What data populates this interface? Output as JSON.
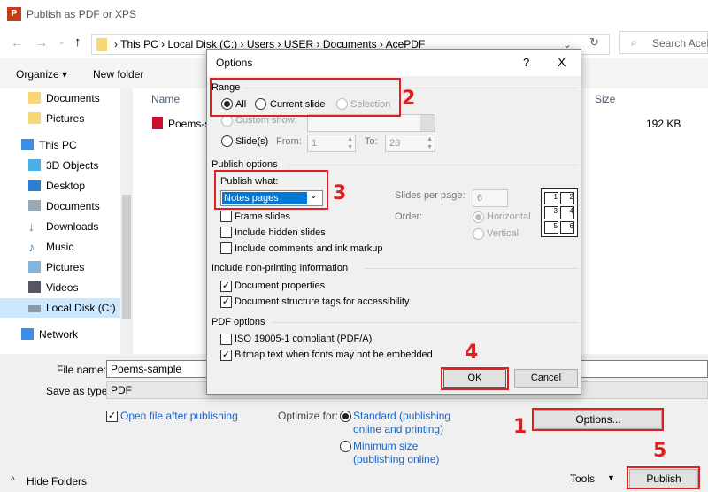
{
  "window": {
    "title": "Publish as PDF or XPS",
    "app_icon": "powerpoint-icon"
  },
  "address": {
    "crumbs": [
      "This PC",
      "Local Disk (C:)",
      "Users",
      "USER",
      "Documents",
      "AcePDF"
    ],
    "search_placeholder": "Search AcePDF"
  },
  "toolbar": {
    "organize": "Organize ▾",
    "new_folder": "New folder"
  },
  "sidebar": {
    "items": [
      {
        "label": "Documents",
        "icon": "folder-icon"
      },
      {
        "label": "Pictures",
        "icon": "folder-icon"
      },
      {
        "label": "This PC",
        "icon": "computer-icon"
      },
      {
        "label": "3D Objects",
        "icon": "cube-icon"
      },
      {
        "label": "Desktop",
        "icon": "desktop-icon"
      },
      {
        "label": "Documents",
        "icon": "documents-icon"
      },
      {
        "label": "Downloads",
        "icon": "download-icon"
      },
      {
        "label": "Music",
        "icon": "music-icon"
      },
      {
        "label": "Pictures",
        "icon": "pictures-icon"
      },
      {
        "label": "Videos",
        "icon": "video-icon"
      },
      {
        "label": "Local Disk (C:)",
        "icon": "drive-icon",
        "selected": true
      },
      {
        "label": "Network",
        "icon": "network-icon"
      }
    ]
  },
  "files": {
    "columns": {
      "name": "Name",
      "size": "Size"
    },
    "rows": [
      {
        "name": "Poems-s",
        "size": "192 KB"
      }
    ]
  },
  "form": {
    "file_name_label": "File name:",
    "file_name": "Poems-sample",
    "type_label": "Save as type:",
    "type": "PDF",
    "open_after": "Open file after publishing",
    "optimize_label": "Optimize for:",
    "standard": "Standard (publishing",
    "standard2": "online and printing)",
    "minimum": "Minimum size",
    "minimum2": "(publishing online)",
    "options": "Options...",
    "hide_folders": "Hide Folders",
    "tools": "Tools",
    "publish": "Publish"
  },
  "dialog": {
    "title": "Options",
    "help": "?",
    "close": "X",
    "range": {
      "label": "Range",
      "all": "All",
      "current": "Current slide",
      "selection": "Selection",
      "custom": "Custom show:",
      "slides": "Slide(s)",
      "from_label": "From:",
      "from": "1",
      "to_label": "To:",
      "to": "28"
    },
    "publish": {
      "label": "Publish options",
      "what_label": "Publish what:",
      "what": "Notes pages",
      "spp_label": "Slides per page:",
      "spp": "6",
      "order_label": "Order:",
      "horizontal": "Horizontal",
      "vertical": "Vertical",
      "frame": "Frame slides",
      "hidden": "Include hidden slides",
      "comments": "Include comments and ink markup",
      "preview": [
        "1",
        "2",
        "3",
        "4",
        "5",
        "6"
      ]
    },
    "nonprint": {
      "label": "Include non-printing information",
      "props": "Document properties",
      "tags": "Document structure tags for accessibility"
    },
    "pdf": {
      "label": "PDF options",
      "iso": "ISO 19005-1 compliant (PDF/A)",
      "bitmap": "Bitmap text when fonts may not be embedded"
    },
    "ok": "OK",
    "cancel": "Cancel"
  },
  "annotations": [
    "1",
    "2",
    "3",
    "4",
    "5"
  ],
  "colors": {
    "highlight": "#e02020",
    "selection": "#0078d7",
    "link": "#1a63c4"
  }
}
